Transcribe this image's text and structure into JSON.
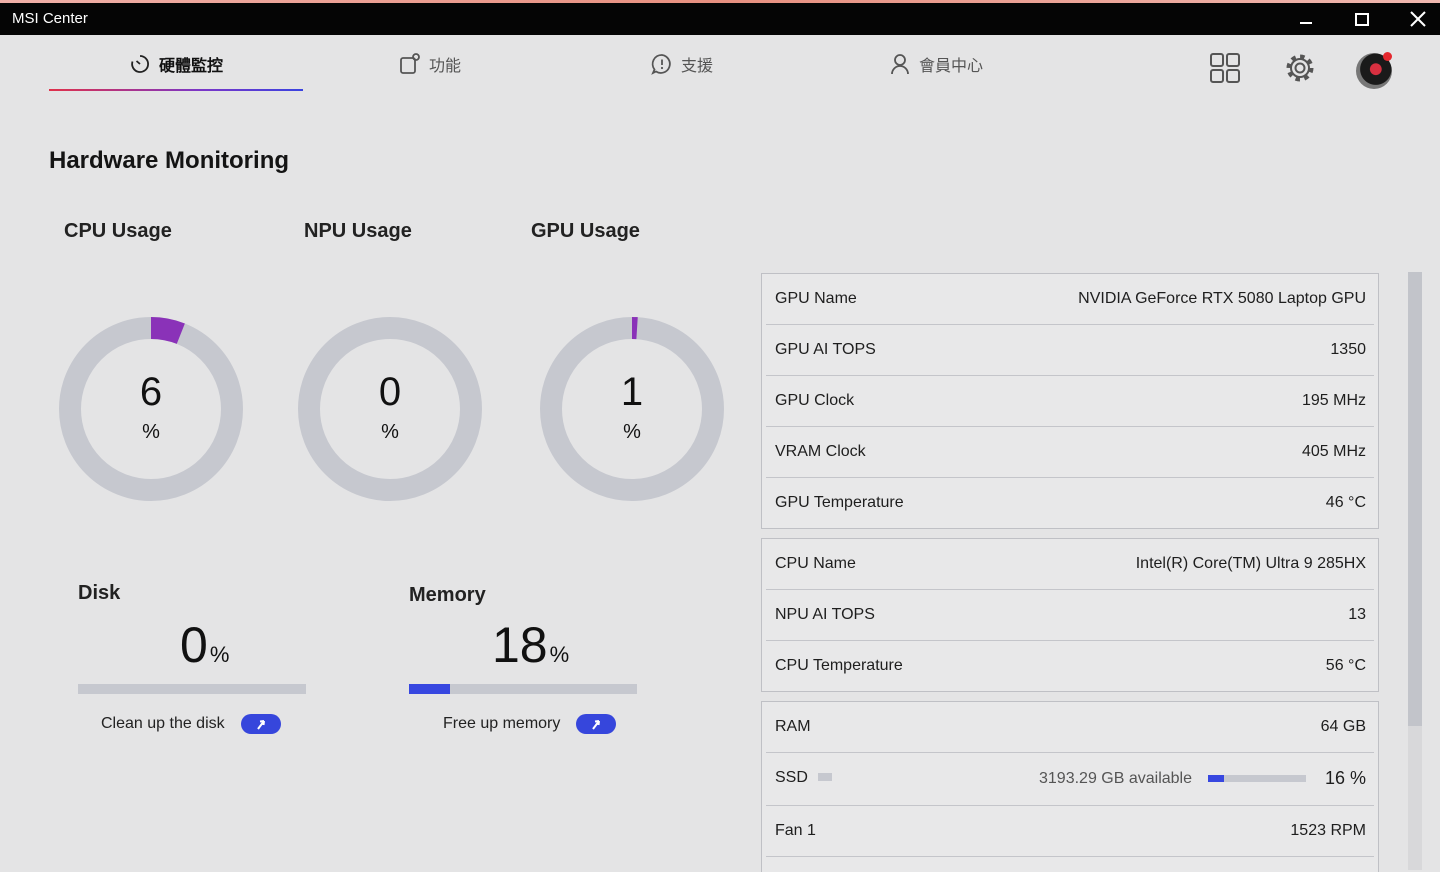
{
  "window": {
    "title": "MSI Center"
  },
  "nav": {
    "tabs": [
      {
        "label": "硬體監控",
        "icon": "monitor-dial-icon"
      },
      {
        "label": "功能",
        "icon": "features-icon"
      },
      {
        "label": "支援",
        "icon": "support-chat-icon"
      },
      {
        "label": "會員中心",
        "icon": "user-icon"
      }
    ]
  },
  "page": {
    "title": "Hardware Monitoring"
  },
  "gauges": [
    {
      "label": "CPU Usage",
      "value": "6",
      "unit": "%",
      "percent": 6
    },
    {
      "label": "NPU Usage",
      "value": "0",
      "unit": "%",
      "percent": 0
    },
    {
      "label": "GPU Usage",
      "value": "1",
      "unit": "%",
      "percent": 1
    }
  ],
  "disk": {
    "label": "Disk",
    "value": "0",
    "unit": "%",
    "percent": 0,
    "action": "Clean up the disk"
  },
  "memory": {
    "label": "Memory",
    "value": "18",
    "unit": "%",
    "percent": 18,
    "action": "Free up memory"
  },
  "gpu_info": [
    {
      "key": "GPU Name",
      "value": "NVIDIA GeForce RTX 5080 Laptop GPU"
    },
    {
      "key": "GPU AI TOPS",
      "value": "1350"
    },
    {
      "key": "GPU Clock",
      "value": "195 MHz"
    },
    {
      "key": "VRAM Clock",
      "value": "405 MHz"
    },
    {
      "key": "GPU Temperature",
      "value": "46 °C"
    }
  ],
  "cpu_info": [
    {
      "key": "CPU Name",
      "value": "Intel(R) Core(TM) Ultra 9 285HX"
    },
    {
      "key": "NPU AI TOPS",
      "value": "13"
    },
    {
      "key": "CPU Temperature",
      "value": "56 °C"
    }
  ],
  "system_info": {
    "ram": {
      "key": "RAM",
      "value": "64 GB"
    },
    "ssd": {
      "key": "SSD",
      "available": "3193.29 GB available",
      "percent": 16,
      "percent_label": "16 %"
    },
    "fan": {
      "key": "Fan 1",
      "value": "1523 RPM"
    }
  },
  "colors": {
    "accent": "#3747e0",
    "gauge_fill": "#8a32b8",
    "gauge_track": "#c6c8cf"
  }
}
